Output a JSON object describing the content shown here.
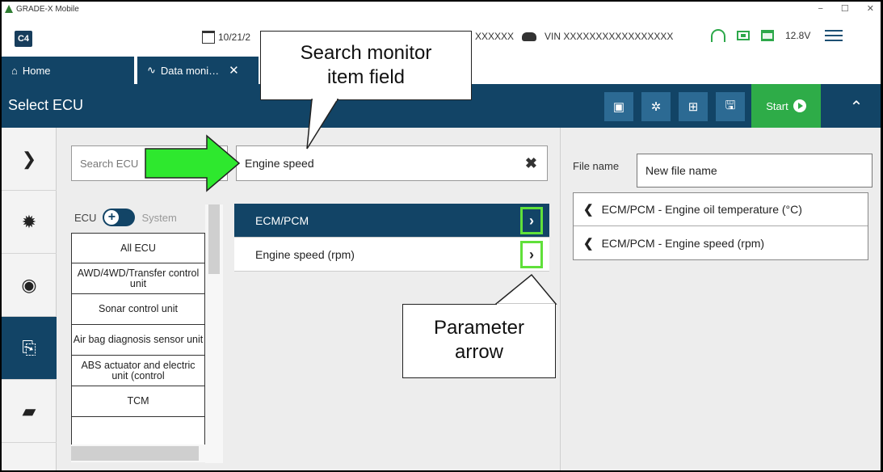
{
  "window": {
    "title": "GRADE-X Mobile",
    "controls": [
      "−",
      "☐",
      "✕"
    ]
  },
  "header": {
    "logo": "C4",
    "date": "10/21/2",
    "vehicle": "XXXXXX",
    "vin": "VIN XXXXXXXXXXXXXXXXX",
    "voltage": "12.8V"
  },
  "tabs": [
    {
      "label": "Home"
    },
    {
      "label": "Data moni…",
      "close": "✕"
    }
  ],
  "toolbar": {
    "title": "Select ECU",
    "start_label": "Start"
  },
  "search": {
    "ecu_placeholder": "Search ECU",
    "monitor_value": "Engine speed",
    "clear": "✖"
  },
  "toggle": {
    "left": "ECU",
    "right": "System"
  },
  "ecu_list": [
    "All ECU",
    "AWD/4WD/Transfer control unit",
    "Sonar control unit",
    "Air bag diagnosis sensor unit",
    "ABS actuator and electric unit (control",
    "TCM"
  ],
  "params": [
    {
      "label": "ECM/PCM",
      "arrow": "›"
    },
    {
      "label": "Engine speed (rpm)",
      "arrow": "›"
    }
  ],
  "file": {
    "label": "File name",
    "value": "New file name"
  },
  "selected_items": [
    "ECM/PCM - Engine oil temperature (°C)",
    "ECM/PCM - Engine speed (rpm)"
  ],
  "callouts": {
    "search": [
      "Search monitor",
      "item field"
    ],
    "arrow": [
      "Parameter",
      "arrow"
    ]
  },
  "colors": {
    "navy": "#124466",
    "green": "#2eac48",
    "highlight": "#60e03a",
    "arrow_fill": "#2ee82e"
  }
}
